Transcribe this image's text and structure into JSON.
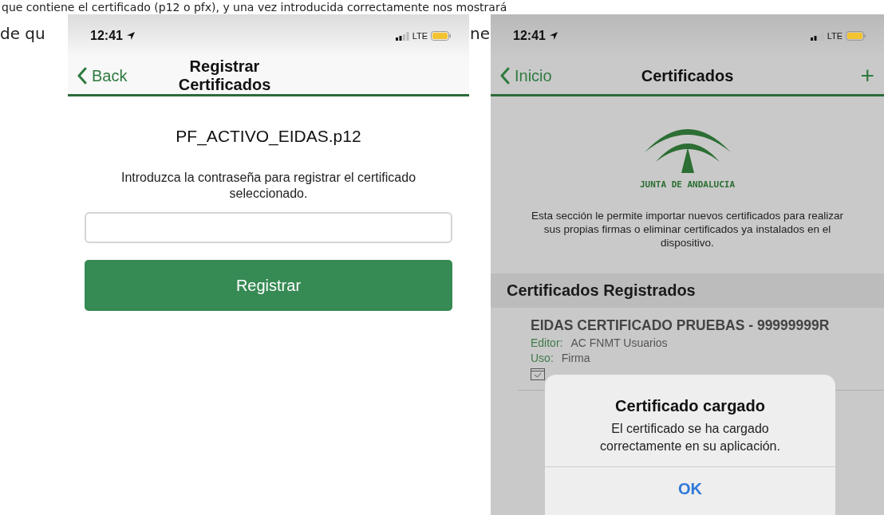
{
  "article": {
    "line_1": "que contiene el certificado (p12 o pfx), y una vez introducida correctamente nos mostrará",
    "line_2_left": "de qu",
    "line_2_middle": "ne"
  },
  "phones": [
    {
      "kind": "register",
      "dimmed": false,
      "status_bar": {
        "time": "12:41",
        "network": "LTE"
      },
      "nav": {
        "back": "Back",
        "title": "Registrar Certificados"
      },
      "filename": "PF_ACTIVO_EIDAS.p12",
      "instructions": "Introduzca la contraseña para registrar el certificado seleccionado.",
      "button": "Registrar"
    },
    {
      "kind": "certificates",
      "dimmed": true,
      "status_bar": {
        "time": "12:41",
        "network": "LTE"
      },
      "nav": {
        "back": "Inicio",
        "title": "Certificados",
        "action": "+"
      },
      "logo_text": "JUNTA DE ANDALUCIA",
      "description": "Esta sección le permite importar nuevos certificados para realizar sus propias firmas o eliminar certificados ya instalados en el dispositivo.",
      "section_title": "Certificados Registrados",
      "certificates": [
        {
          "name": "EIDAS CERTIFICADO PRUEBAS - 99999999R",
          "fields": [
            {
              "label": "Editor:",
              "value": "AC FNMT Usuarios"
            },
            {
              "label": "Uso:",
              "value": "Firma"
            }
          ]
        }
      ],
      "alert": {
        "title": "Certificado cargado",
        "message": "El certificado se ha cargado correctamente en su aplicación.",
        "button": "OK"
      }
    }
  ]
}
